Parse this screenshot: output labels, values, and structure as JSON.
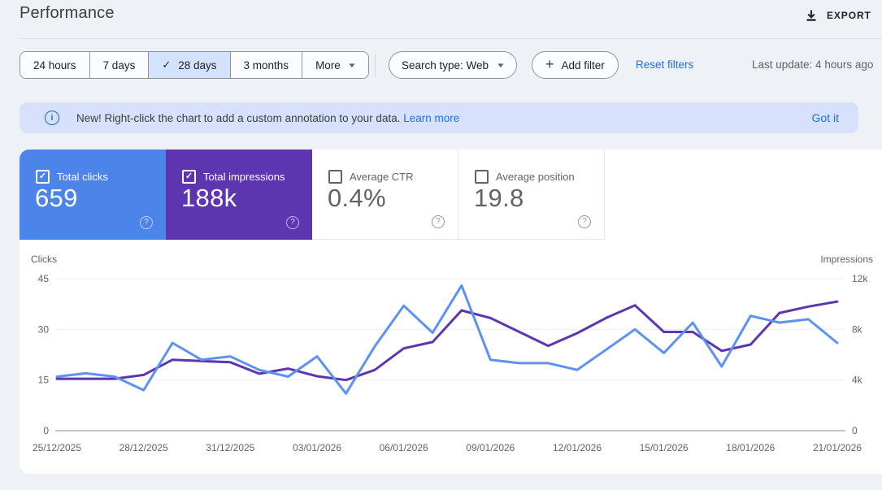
{
  "header": {
    "title": "Performance",
    "export_label": "EXPORT"
  },
  "toolbar": {
    "date_chips": [
      {
        "label": "24 hours",
        "selected": false,
        "dropdown": false
      },
      {
        "label": "7 days",
        "selected": false,
        "dropdown": false
      },
      {
        "label": "28 days",
        "selected": true,
        "dropdown": false
      },
      {
        "label": "3 months",
        "selected": false,
        "dropdown": false
      },
      {
        "label": "More",
        "selected": false,
        "dropdown": true
      }
    ],
    "search_type_label": "Search type: Web",
    "add_filter_label": "Add filter",
    "reset_filters_label": "Reset filters",
    "last_update": "Last update: 4 hours ago"
  },
  "banner": {
    "text": "New! Right-click the chart to add a custom annotation to your data.",
    "link": "Learn more",
    "dismiss": "Got it"
  },
  "metric_cards": [
    {
      "label": "Total clicks",
      "value": "659",
      "checked": true,
      "color": "#4c84e9"
    },
    {
      "label": "Total impressions",
      "value": "188k",
      "checked": true,
      "color": "#5e35b1"
    },
    {
      "label": "Average CTR",
      "value": "0.4%",
      "checked": false,
      "color": ""
    },
    {
      "label": "Average position",
      "value": "19.8",
      "checked": false,
      "color": ""
    }
  ],
  "icons": {
    "check": "✓",
    "caret": "▼",
    "plus": "+",
    "info": "i",
    "help": "?",
    "download": "download-icon"
  },
  "colors": {
    "page_bg": "#eef1f5",
    "card_bg": "#ffffff",
    "banner_bg": "#d7e1fc",
    "selected_chip_bg": "#d3e3fd",
    "link_blue": "#1a73e8",
    "clicks_line": "#5d91f2",
    "impressions_line": "#5e35b1",
    "grid_light": "#ededef",
    "axis_line": "#c4c7ca",
    "axis_text": "#5f6368"
  },
  "chart_data": {
    "type": "line",
    "x_dates": [
      "25/12/2025",
      "26/12/2025",
      "27/12/2025",
      "28/12/2025",
      "29/12/2025",
      "30/12/2025",
      "31/12/2025",
      "01/01/2026",
      "02/01/2026",
      "03/01/2026",
      "04/01/2026",
      "05/01/2026",
      "06/01/2026",
      "07/01/2026",
      "08/01/2026",
      "09/01/2026",
      "10/01/2026",
      "11/01/2026",
      "12/01/2026",
      "13/01/2026",
      "14/01/2026",
      "15/01/2026",
      "16/01/2026",
      "17/01/2026",
      "18/01/2026",
      "19/01/2026",
      "20/01/2026",
      "21/01/2026"
    ],
    "x_tick_labels": [
      "25/12/2025",
      "28/12/2025",
      "31/12/2025",
      "03/01/2026",
      "06/01/2026",
      "09/01/2026",
      "12/01/2026",
      "15/01/2026",
      "18/01/2026",
      "21/01/2026"
    ],
    "series": [
      {
        "name": "Clicks",
        "axis": "left",
        "color": "#5d91f2",
        "values": [
          16,
          17,
          16,
          12,
          26,
          21,
          22,
          18,
          16,
          22,
          11,
          25,
          37,
          29,
          43,
          21,
          20,
          20,
          18,
          24,
          30,
          23,
          32,
          19,
          34,
          32,
          33,
          26
        ]
      },
      {
        "name": "Impressions",
        "axis": "right",
        "color": "#5e35b1",
        "values": [
          4100,
          4100,
          4100,
          4400,
          5600,
          5500,
          5400,
          4500,
          4900,
          4300,
          4000,
          4800,
          6500,
          7000,
          9500,
          8900,
          7800,
          6700,
          7700,
          8900,
          9900,
          7800,
          7800,
          6300,
          6800,
          9300,
          9800,
          10200
        ]
      }
    ],
    "left_axis": {
      "label": "Clicks",
      "ticks": [
        0,
        15,
        30,
        45
      ],
      "max": 45
    },
    "right_axis": {
      "label": "Impressions",
      "ticks": [
        "0",
        "4k",
        "8k",
        "12k"
      ],
      "tick_values": [
        0,
        4000,
        8000,
        12000
      ],
      "max": 12000
    },
    "grid": true,
    "legend_position": "none"
  }
}
